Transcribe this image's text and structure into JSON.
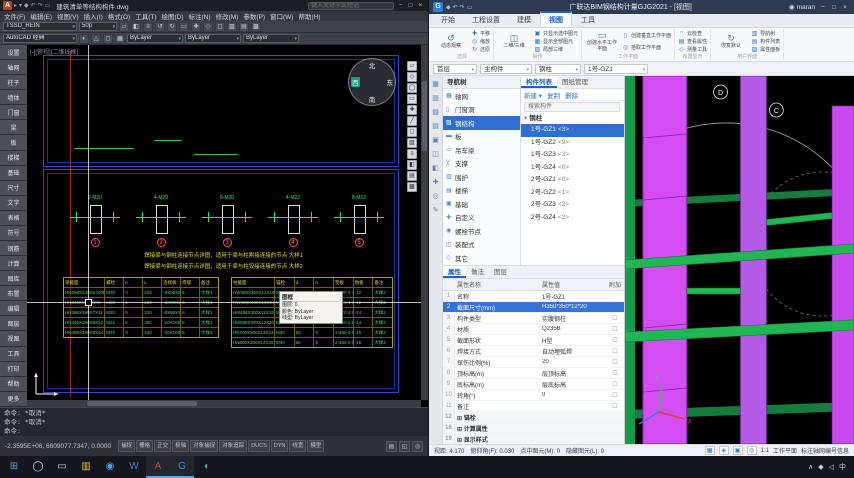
{
  "taskbar": {
    "icons": [
      {
        "name": "start",
        "glyph": "⊞",
        "color": "#5aa7f0"
      },
      {
        "name": "search",
        "glyph": "◯",
        "color": "#c9d2dd"
      },
      {
        "name": "task-view",
        "glyph": "▭",
        "color": "#c9d2dd"
      },
      {
        "name": "file-explorer",
        "glyph": "▥",
        "color": "#e8c34a"
      },
      {
        "name": "edge-browser",
        "glyph": "◉",
        "color": "#4da3ff"
      },
      {
        "name": "word",
        "glyph": "W",
        "color": "#4a7fd4"
      },
      {
        "name": "autocad",
        "glyph": "A",
        "color": "#e0452e",
        "active": true
      },
      {
        "name": "glodon-bim",
        "glyph": "G",
        "color": "#3f8cff",
        "active": true
      },
      {
        "name": "wechat",
        "glyph": "◖",
        "color": "#3ec460"
      }
    ],
    "tray": [
      {
        "name": "tray-expand",
        "glyph": "∧"
      },
      {
        "name": "tray-network",
        "glyph": "◆"
      },
      {
        "name": "tray-volume",
        "glyph": "◁"
      },
      {
        "name": "input-language",
        "glyph": "中"
      }
    ]
  },
  "acad": {
    "titlebar": {
      "logo": "A",
      "quick_icons": [
        "▸",
        "▾",
        "◆",
        "↶",
        "↷",
        "▭"
      ],
      "title": "建筑清单等结构构件.dwg",
      "search_placeholder": "键入关键字或短语",
      "window_icons": [
        "−",
        "□",
        "×"
      ]
    },
    "menu": [
      "文件(F)",
      "编辑(E)",
      "视图(V)",
      "插入(I)",
      "格式(O)",
      "工具(T)",
      "绘图(D)",
      "标注(N)",
      "修改(M)",
      "参数(P)",
      "窗口(W)",
      "帮助(H)"
    ],
    "toolbar1": {
      "style_combo": "TSSD_REIN",
      "scale_combo": "50p",
      "icons": [
        "▱",
        "◧",
        "≡",
        "↺",
        "↻",
        "▭",
        "✚",
        "◇",
        "◻",
        "▨",
        "▤",
        "▩"
      ]
    },
    "toolbar2": {
      "workspace_combo": "AutoCAD 经典",
      "layer_icons": [
        "◐",
        "△",
        "◻",
        "▦"
      ],
      "color_combo": "ByLayer",
      "linetype_combo": "ByLayer",
      "lineweight_combo": "ByLayer"
    },
    "palette": [
      "设置",
      "轴网",
      "柱子",
      "墙体",
      "门窗",
      "梁",
      "板",
      "楼梯",
      "基础",
      "尺寸",
      "文字",
      "表格",
      "符号",
      "钢筋",
      "计算",
      "图库",
      "布置",
      "编辑",
      "图层",
      "视图",
      "工具",
      "打印",
      "帮助",
      "更多"
    ],
    "canvas": {
      "viewport_label": "[-][俯视][二维线框]",
      "compass": {
        "north": "北",
        "south": "南",
        "west": "西",
        "east": "东"
      },
      "side_toolbar": [
        "▱",
        "◇",
        "◯",
        "▭",
        "✚",
        "╱",
        "◻",
        "▨",
        "≡",
        "◧",
        "▤",
        "▩"
      ],
      "details": [
        {
          "num": "1",
          "dim": "2-M20"
        },
        {
          "num": "2",
          "dim": "4-M20"
        },
        {
          "num": "3",
          "dim": "6-M20"
        },
        {
          "num": "4",
          "dim": "4-M22"
        },
        {
          "num": "5",
          "dim": "8-M22"
        }
      ],
      "captions": [
        "焊接梁与钢柱连接节点详图，适用于梁与柱刚接连接的节点  大样1",
        "焊接梁与钢柱连接节点详图，适用于梁与柱铰接连接的节点  大样2"
      ],
      "table_left": {
        "headers": [
          "梁截面",
          "螺栓",
          "n",
          "L",
          "连接板",
          "焊缝",
          "备注"
        ],
        "rows": [
          [
            "HN298X149X5.5X8",
            "M20",
            "4",
            "220",
            "-8X90X220",
            "6",
            "大样1"
          ],
          [
            "HN346X174X6X9",
            "M20",
            "4",
            "260",
            "-8X90X260",
            "6",
            "大样1"
          ],
          [
            "HN396X199X7X11",
            "M20",
            "6",
            "320",
            "-8X90X320",
            "8",
            "大样1"
          ],
          [
            "HN446X199X8X12",
            "M22",
            "6",
            "360",
            "-10X100X360",
            "8",
            "大样1"
          ],
          [
            "HN496X199X9X14",
            "M22",
            "8",
            "420",
            "-10X100X420",
            "8",
            "大样2"
          ]
        ]
      },
      "table_right": {
        "headers": [
          "柱截面",
          "锚栓",
          "d",
          "n",
          "垫板",
          "肋板",
          "备注"
        ],
        "rows": [
          [
            "HW350X350X12X19",
            "M24",
            "45",
            "4",
            "2-380 4 75X14",
            "-12",
            "大样2"
          ],
          [
            "HW400X400X13X21",
            "M24",
            "45",
            "4",
            "2-380 4 75X14",
            "-12",
            "大样2"
          ],
          [
            "HM488X300X11X18",
            "M27",
            "50",
            "6",
            "2-420 4 80X16",
            "-14",
            "大样2"
          ],
          [
            "HM588X300X12X20",
            "M27",
            "50",
            "6",
            "2-420 4 80X16",
            "-14",
            "大样2"
          ],
          [
            "HN700X300X13X24",
            "M30",
            "55",
            "8",
            "2-480 4 90X18",
            "-16",
            "大样2"
          ],
          [
            "HN800X300X14X26",
            "M30",
            "55",
            "8",
            "2-480 4 90X18",
            "-16",
            "大样2"
          ]
        ]
      },
      "tooltip": {
        "title": "图框",
        "rows": [
          "图层: 0",
          "颜色: ByLayer",
          "线型: ByLayer"
        ]
      }
    },
    "command_lines": [
      "命令: *取消*",
      "命令: *取消*",
      "命令:"
    ],
    "statusbar": {
      "coords": "-2.3595E+06, 6609077.7347, 0.0000",
      "toggles": [
        "捕捉",
        "栅格",
        "正交",
        "极轴",
        "对象捕捉",
        "对象追踪",
        "DUCS",
        "DYN",
        "线宽",
        "模型"
      ],
      "right_icons": [
        "▤",
        "◱",
        "◎"
      ]
    }
  },
  "bim": {
    "titlebar": {
      "logo": "G",
      "quick_icons": [
        "◆",
        "↶",
        "↷",
        "▭"
      ],
      "title": "广联达BIM钢结构计量GJG2021 - [视图]",
      "user_icon": "◉",
      "user": "maran",
      "window_icons": [
        "−",
        "□",
        "×"
      ]
    },
    "tabs": [
      {
        "label": "开始"
      },
      {
        "label": "工程设置"
      },
      {
        "label": "建模"
      },
      {
        "label": "视图",
        "active": true
      },
      {
        "label": "工具"
      }
    ],
    "ribbon_groups": [
      {
        "label": "选择",
        "big": {
          "label": "动态观察",
          "glyph": "↺"
        },
        "small": [
          {
            "label": "平移",
            "glyph": "✚"
          },
          {
            "label": "缩放",
            "glyph": "◎"
          },
          {
            "label": "还原",
            "glyph": "↻"
          }
        ]
      },
      {
        "label": "操作",
        "big": {
          "label": "二维/三维",
          "glyph": "◫"
        },
        "small": [
          {
            "label": "只显示选中图元",
            "glyph": "▣"
          },
          {
            "label": "显示全部图元",
            "glyph": "▦"
          },
          {
            "label": "局部三维",
            "glyph": "▧"
          }
        ]
      },
      {
        "label": "工作平面",
        "big": {
          "label": "创建水平工作平面",
          "glyph": "▭"
        },
        "small": [
          {
            "label": "创建垂直工作平面",
            "glyph": "▯"
          },
          {
            "label": "拾取工作平面",
            "glyph": "◎"
          }
        ]
      },
      {
        "label": "布置显示",
        "small": [
          {
            "label": "云检查",
            "glyph": "○"
          },
          {
            "label": "查看属性",
            "glyph": "▤"
          },
          {
            "label": "测量工具",
            "glyph": "◇"
          }
        ]
      },
      {
        "label": "用户界面",
        "big": {
          "label": "恢复默认",
          "glyph": "↻"
        },
        "small": [
          {
            "label": "导航树",
            "glyph": "▥"
          },
          {
            "label": "构件列表",
            "glyph": "▤"
          },
          {
            "label": "属性面板",
            "glyph": "▧"
          }
        ]
      }
    ],
    "combos": [
      {
        "value": "首层"
      },
      {
        "value": "主构件"
      },
      {
        "value": "钢柱"
      },
      {
        "value": "1号-GZ1"
      }
    ],
    "strip_icons": [
      "▦",
      "▥",
      "▨",
      "▤",
      "▣",
      "◫",
      "◧",
      "✚",
      "◎",
      "✎"
    ],
    "nav": {
      "title": "导航树",
      "items": [
        {
          "label": "轴网",
          "glyph": "▦"
        },
        {
          "label": "门窗洞",
          "glyph": "▯"
        },
        {
          "label": "钢结构",
          "glyph": "▨",
          "selected": true
        },
        {
          "label": "板",
          "glyph": "▬"
        },
        {
          "label": "吊车梁",
          "glyph": "▭"
        },
        {
          "label": "支撑",
          "glyph": "╳"
        },
        {
          "label": "围护",
          "glyph": "▥"
        },
        {
          "label": "楼梯",
          "glyph": "▤"
        },
        {
          "label": "基础",
          "glyph": "▣"
        },
        {
          "label": "自定义",
          "glyph": "✚"
        },
        {
          "label": "螺栓节点",
          "glyph": "◉"
        },
        {
          "label": "装配式",
          "glyph": "◫"
        },
        {
          "label": "其它",
          "glyph": "◇"
        }
      ]
    },
    "components": {
      "tabs": [
        {
          "label": "构件列表",
          "active": true
        },
        {
          "label": "图纸管理"
        }
      ],
      "actions": [
        "新建 ▾",
        "复制",
        "删除"
      ],
      "search_placeholder": "搜索构件",
      "group": "钢柱",
      "items": [
        {
          "name": "1号-GZ1",
          "count": "<3>",
          "selected": true
        },
        {
          "name": "1号-GZ2",
          "count": "<9>"
        },
        {
          "name": "1号-GZ3",
          "count": "<3>"
        },
        {
          "name": "1号-GZ4",
          "count": "<0>"
        },
        {
          "name": "2号-GZ1",
          "count": "<0>"
        },
        {
          "name": "2号-GZ2",
          "count": "<1>"
        },
        {
          "name": "2号-GZ3",
          "count": "<2>"
        },
        {
          "name": "2号-GZ4",
          "count": "<2>"
        }
      ]
    },
    "properties": {
      "tabs": [
        {
          "label": "属性",
          "active": true
        },
        {
          "label": "做法"
        },
        {
          "label": "图层"
        }
      ],
      "headers": [
        "属性名称",
        "属性值",
        "附加"
      ],
      "rows": [
        {
          "n": "1",
          "name": "名称",
          "value": "1号-GZ1"
        },
        {
          "n": "2",
          "name": "截面尺寸(mm)",
          "value": "H350*350*12*20",
          "selected": true
        },
        {
          "n": "3",
          "name": "构件类型",
          "value": "实腹钢柱",
          "check": true
        },
        {
          "n": "4",
          "name": "材质",
          "value": "Q235B",
          "check": true
        },
        {
          "n": "5",
          "name": "截面形状",
          "value": "H型",
          "check": true
        },
        {
          "n": "6",
          "name": "焊接方式",
          "value": "自动埋弧焊",
          "check": true
        },
        {
          "n": "7",
          "name": "探伤比例(%)",
          "value": "20",
          "check": true
        },
        {
          "n": "8",
          "name": "顶标高(m)",
          "value": "层顶标高",
          "check": true
        },
        {
          "n": "9",
          "name": "底标高(m)",
          "value": "层底标高",
          "check": true
        },
        {
          "n": "10",
          "name": "转角(°)",
          "value": "0",
          "check": true
        },
        {
          "n": "11",
          "name": "备注",
          "value": "",
          "check": true
        },
        {
          "n": "12",
          "name": "⊞ 锚栓",
          "value": "",
          "group": true
        },
        {
          "n": "16",
          "name": "⊞ 计算属性",
          "value": "",
          "group": true
        },
        {
          "n": "19",
          "name": "⊞ 显示样式",
          "value": "",
          "group": true
        }
      ]
    },
    "viewport": {
      "bubble1": "D",
      "bubble2": "C",
      "axis_x": "X",
      "axis_y": "Y"
    },
    "statusbar": {
      "entries": [
        {
          "label": "视距:",
          "value": "4.170"
        },
        {
          "label": "俯仰角(F):",
          "value": "0.030"
        },
        {
          "label": "点中图元(M):",
          "value": "0"
        },
        {
          "label": "隐藏图元(L):",
          "value": "0"
        }
      ],
      "toggles": [
        "▦",
        "◈",
        "▣",
        "◎"
      ],
      "right": [
        "1:1",
        "工作平面",
        "标注轴网编号信息"
      ]
    }
  }
}
